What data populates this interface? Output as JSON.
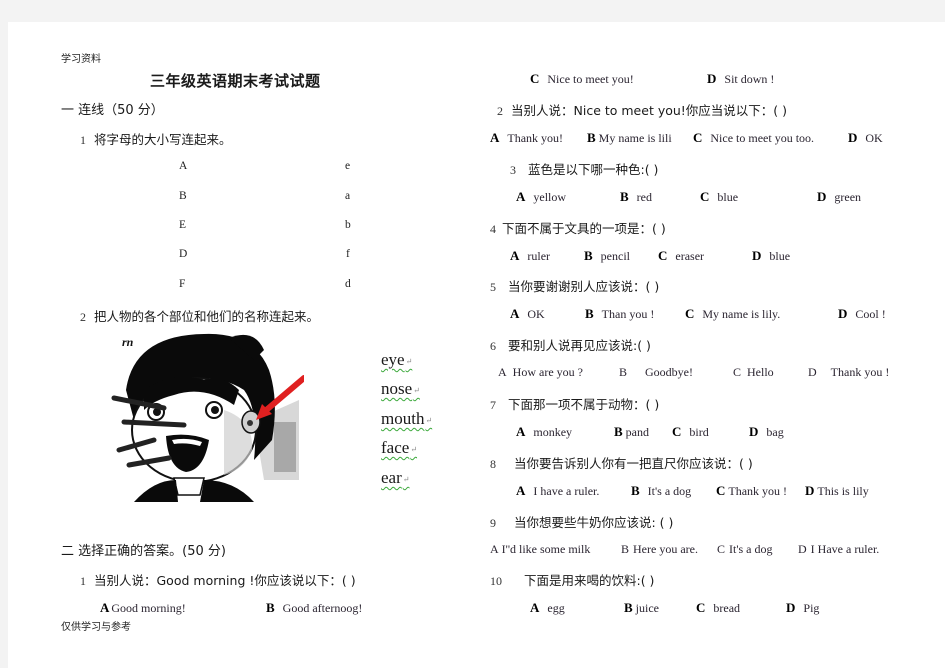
{
  "header_note": "学习资料",
  "footer_note": "仅供学习与参考",
  "title": "三年级英语期末考试试题",
  "section1": {
    "label": "一  连线（50 分）",
    "q1": {
      "num": "1",
      "text": "将字母的大小写连起来。"
    },
    "uppercase": [
      "A",
      "B",
      "E",
      "D",
      "F"
    ],
    "lowercase": [
      "e",
      "a",
      "b",
      "f",
      "d"
    ],
    "q2": {
      "num": "2",
      "text": "把人物的各个部位和他们的名称连起来。"
    },
    "picture_caption": "girl-face-illustration",
    "words": [
      "eye",
      "nose",
      "mouth",
      "face",
      "ear"
    ],
    "paragraph_mark": "↵"
  },
  "section2": {
    "label": "二  选择正确的答案。(50 分)",
    "questions": [
      {
        "num": "1",
        "text": "当别人说：Good  morning  !你应该说以下：(   )",
        "options": [
          {
            "letter": "A",
            "text": "Good  morning!"
          },
          {
            "letter": "B",
            "text": "Good  afternoog!"
          },
          {
            "letter": "C",
            "text": "Nice  to  meet  you!"
          },
          {
            "letter": "D",
            "text": "Sit  down  !"
          }
        ]
      },
      {
        "num": "2",
        "text": "当别人说：Nice  to  meet  you!你应当说以下：(    )",
        "options": [
          {
            "letter": "A",
            "text": "Thank  you!"
          },
          {
            "letter": "B",
            "text": "My  name  is  lili"
          },
          {
            "letter": "C",
            "text": "Nice  to  meet  you  too."
          },
          {
            "letter": "D",
            "text": "OK"
          }
        ]
      },
      {
        "num": "3",
        "text": "蓝色是以下哪一种色:(      )",
        "options": [
          {
            "letter": "A",
            "text": "yellow"
          },
          {
            "letter": "B",
            "text": "red"
          },
          {
            "letter": "C",
            "text": "blue"
          },
          {
            "letter": "D",
            "text": "green"
          }
        ]
      },
      {
        "num": "4",
        "text": "下面不属于文具的一项是：(    )",
        "options": [
          {
            "letter": "A",
            "text": "ruler"
          },
          {
            "letter": "B",
            "text": "pencil"
          },
          {
            "letter": "C",
            "text": "eraser"
          },
          {
            "letter": "D",
            "text": "blue"
          }
        ]
      },
      {
        "num": "5",
        "text": "当你要谢谢别人应该说：(    )",
        "options": [
          {
            "letter": "A",
            "text": "OK"
          },
          {
            "letter": "B",
            "text": "Than  you  !"
          },
          {
            "letter": "C",
            "text": "My  name  is  lily."
          },
          {
            "letter": "D",
            "text": "Cool  !"
          }
        ]
      },
      {
        "num": "6",
        "text": "要和别人说再见应该说:(      )",
        "options": [
          {
            "letter": "A",
            "text": "How  are  you  ?"
          },
          {
            "letter": "B",
            "text": "Goodbye!"
          },
          {
            "letter": "C",
            "text": "Hello"
          },
          {
            "letter": "D",
            "text": "Thank  you  !"
          }
        ]
      },
      {
        "num": "7",
        "text": "下面那一项不属于动物：(      )",
        "options": [
          {
            "letter": "A",
            "text": "monkey"
          },
          {
            "letter": "B",
            "text": "pand"
          },
          {
            "letter": "C",
            "text": "bird"
          },
          {
            "letter": "D",
            "text": "bag"
          }
        ]
      },
      {
        "num": "8",
        "text": "当你要告诉别人你有一把直尺你应该说：(    )",
        "options": [
          {
            "letter": "A",
            "text": "I  have  a  ruler."
          },
          {
            "letter": "B",
            "text": "It's  a  dog"
          },
          {
            "letter": "C",
            "text": "Thank  you  !"
          },
          {
            "letter": "D",
            "text": "This  is  lily"
          }
        ]
      },
      {
        "num": "9",
        "text": "当你想要些牛奶你应该说: (      )",
        "options": [
          {
            "letter": "A",
            "text": "I''d  like  some  milk"
          },
          {
            "letter": "B",
            "text": "Here  you  are."
          },
          {
            "letter": "C",
            "text": "It's  a  dog"
          },
          {
            "letter": "D",
            "text": "I  Have  a  ruler."
          }
        ]
      },
      {
        "num": "10",
        "text": "下面是用来喝的饮料:(      )",
        "options": [
          {
            "letter": "A",
            "text": "egg"
          },
          {
            "letter": "B",
            "text": "juice"
          },
          {
            "letter": "C",
            "text": "bread"
          },
          {
            "letter": "D",
            "text": "Pig"
          }
        ]
      }
    ]
  },
  "colors": {
    "arrow": "#e02020",
    "spellcheck_underline": "#3aa83a",
    "page_bg": "#ffffff",
    "canvas_bg": "#f3f3f3"
  }
}
